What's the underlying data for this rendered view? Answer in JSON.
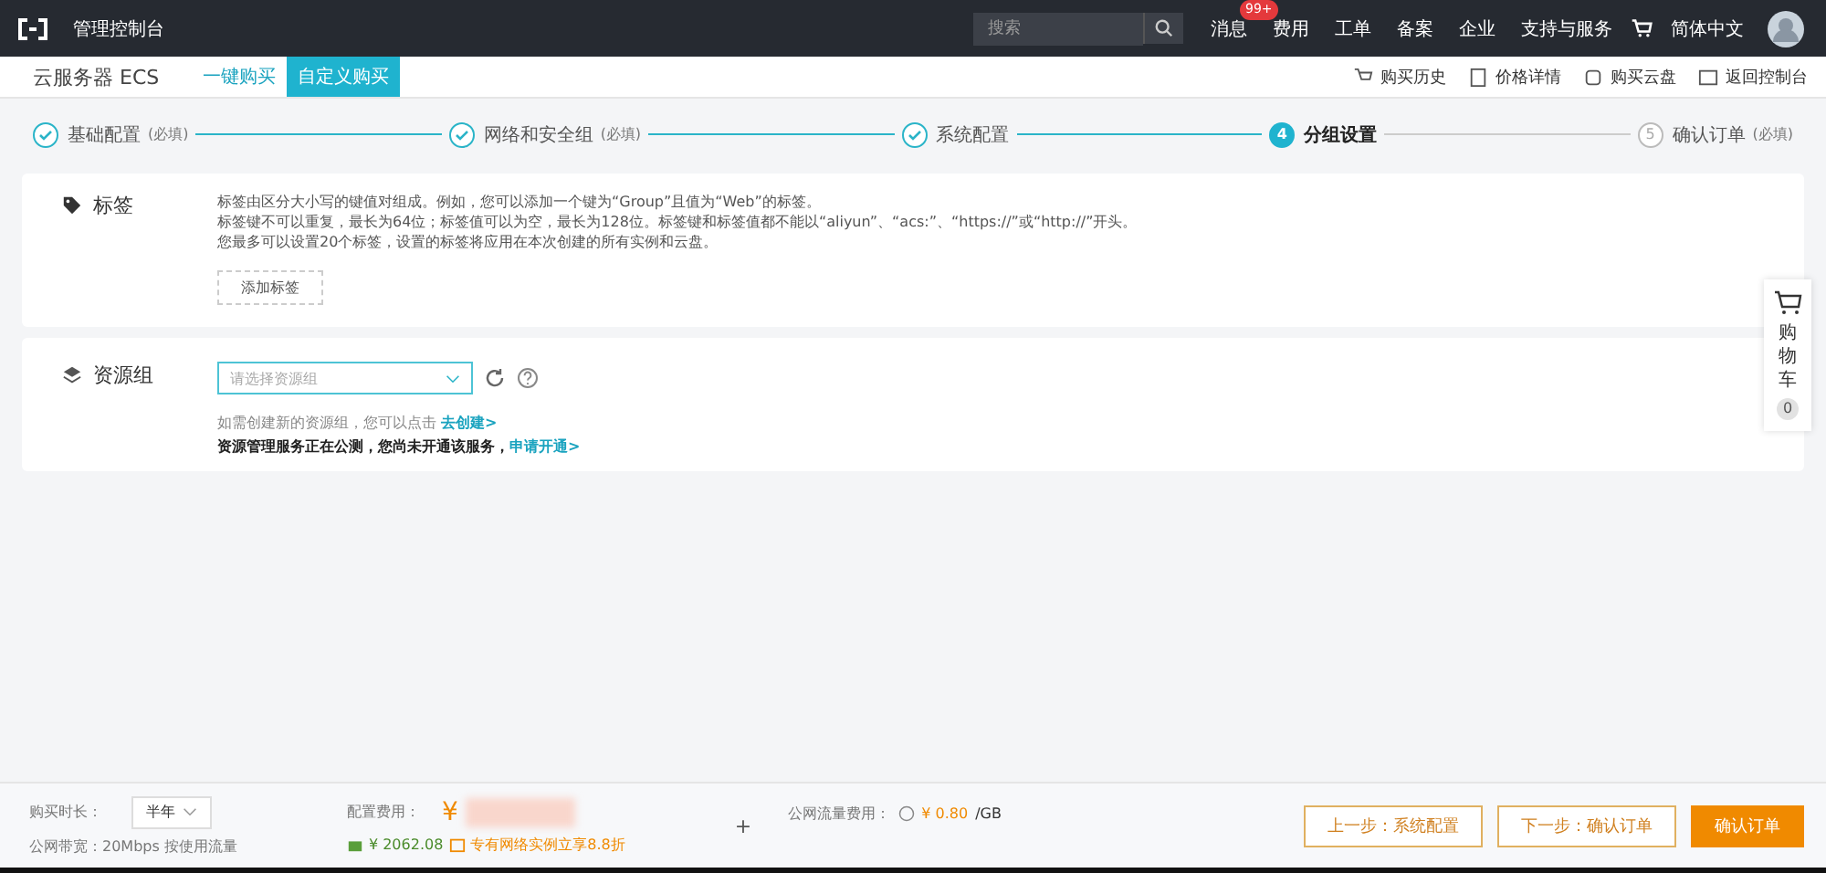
{
  "topbar": {
    "title": "管理控制台",
    "search": {
      "placeholder": "搜索"
    },
    "nav": [
      {
        "label": "消息",
        "badge": "99+"
      },
      {
        "label": "费用"
      },
      {
        "label": "工单"
      },
      {
        "label": "备案"
      },
      {
        "label": "企业"
      },
      {
        "label": "支持与服务"
      },
      {
        "label": "简体中文"
      }
    ]
  },
  "subbar": {
    "product": "云服务器 ECS",
    "tabs": [
      {
        "label": "一键购买",
        "selected": false
      },
      {
        "label": "自定义购买",
        "selected": true
      }
    ],
    "links": [
      {
        "kind": "history",
        "label": "购买历史"
      },
      {
        "kind": "price",
        "label": "价格详情"
      },
      {
        "kind": "disk",
        "label": "购买云盘"
      },
      {
        "kind": "back",
        "label": "返回控制台"
      }
    ]
  },
  "steps": [
    {
      "label": "基础配置",
      "note": "(必填)",
      "done": true,
      "current": false
    },
    {
      "label": "网络和安全组",
      "note": "(必填)",
      "done": true,
      "current": false
    },
    {
      "label": "系统配置",
      "done": true,
      "current": false
    },
    {
      "number": "4",
      "label": "分组设置",
      "done": false,
      "current": true
    },
    {
      "number": "5",
      "label": "确认订单",
      "note": "(必填)",
      "done": false,
      "current": false
    }
  ],
  "tags": {
    "label": "标签",
    "lines": [
      "标签由区分大小写的键值对组成。例如，您可以添加一个键为“Group”且值为“Web”的标签。",
      "标签键不可以重复，最长为64位；标签值可以为空，最长为128位。标签键和标签值都不能以“aliyun”、“acs:”、“https://”或“http://”开头。",
      "您最多可以设置20个标签，设置的标签将应用在本次创建的所有实例和云盘。"
    ],
    "button": "添加标签"
  },
  "resource_group": {
    "label": "资源组",
    "placeholder": "请选择资源组",
    "hint": "如需创建新的资源组，您可以点击",
    "hint_link": "去创建>",
    "notice": "资源管理服务正在公测，您尚未开通该服务，",
    "notice_link": "申请开通>"
  },
  "cart": {
    "label": "购物车",
    "count": "0"
  },
  "footer": {
    "duration_label": "购买时长：",
    "duration": "半年",
    "bandwidth": "公网带宽：20Mbps 按使用流量",
    "config_label": "配置费用：",
    "currency": "¥",
    "saving": "¥ 2062.08",
    "promo": "专有网络实例立享8.8折",
    "plus": "+",
    "traffic_label": "公网流量费用：",
    "traffic_price": "¥ 0.80",
    "traffic_unit": "/GB",
    "buttons": [
      {
        "kind": "secondary",
        "label": "上一步：系统配置"
      },
      {
        "kind": "secondary",
        "label": "下一步：确认订单"
      },
      {
        "kind": "primary",
        "label": "确认订单"
      }
    ]
  }
}
